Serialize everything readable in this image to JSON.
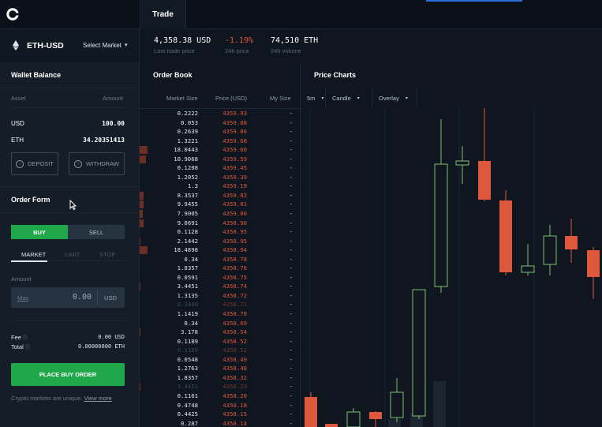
{
  "topbar": {
    "tab_trade": "Trade"
  },
  "market": {
    "pair": "ETH-USD",
    "select_label": "Select Market",
    "caret": "▾"
  },
  "stats": [
    {
      "value": "4,358.38 USD",
      "label": "Last trade price",
      "color": "#ffffff"
    },
    {
      "value": "-1.19%",
      "label": "24h price",
      "color": "#e0583b"
    },
    {
      "value": "74,510 ETH",
      "label": "24h volume",
      "color": "#ffffff"
    }
  ],
  "wallet": {
    "title": "Wallet Balance",
    "col_asset": "Asset",
    "col_amount": "Amount",
    "rows": [
      {
        "asset": "USD",
        "amount": "100.00"
      },
      {
        "asset": "ETH",
        "amount": "34.20351413"
      }
    ],
    "deposit": "DEPOSIT",
    "withdraw": "WITHDRAW"
  },
  "order_form": {
    "title": "Order Form",
    "buy": "BUY",
    "sell": "SELL",
    "types": [
      "MARKET",
      "LIMIT",
      "STOP"
    ],
    "amount_label": "Amount",
    "max": "Max",
    "amount_value": "0.00",
    "amount_unit": "USD",
    "fee_label": "Fee",
    "fee_value": "0.00 USD",
    "total_label": "Total",
    "total_value": "0.00000000 ETH",
    "info_mark": "ⓘ",
    "place_button": "PLACE BUY ORDER",
    "disclaimer": "Crypto markets are unique.",
    "view_more": "View more"
  },
  "order_book": {
    "title": "Order Book",
    "col_market_size": "Market Size",
    "col_price": "Price (USD)",
    "col_my_size": "My Size",
    "rows": [
      {
        "size": "0.2222",
        "price": "4359.93",
        "depth": 0
      },
      {
        "size": "0.053",
        "price": "4359.88",
        "depth": 0
      },
      {
        "size": "0.2639",
        "price": "4359.86",
        "depth": 0
      },
      {
        "size": "1.3221",
        "price": "4359.68",
        "depth": 0
      },
      {
        "size": "18.0443",
        "price": "4359.60",
        "depth": 10
      },
      {
        "size": "10.9068",
        "price": "4359.59",
        "depth": 8
      },
      {
        "size": "0.1208",
        "price": "4359.45",
        "depth": 0
      },
      {
        "size": "1.2052",
        "price": "4359.39",
        "depth": 0
      },
      {
        "size": "1.3",
        "price": "4359.19",
        "depth": 0
      },
      {
        "size": "8.3537",
        "price": "4359.02",
        "depth": 5
      },
      {
        "size": "9.9455",
        "price": "4359.01",
        "depth": 5
      },
      {
        "size": "7.9005",
        "price": "4359.00",
        "depth": 4
      },
      {
        "size": "9.0691",
        "price": "4358.98",
        "depth": 5
      },
      {
        "size": "0.1128",
        "price": "4358.95",
        "depth": 0
      },
      {
        "size": "2.1442",
        "price": "4358.95",
        "depth": 1
      },
      {
        "size": "18.4898",
        "price": "4358.94",
        "depth": 10
      },
      {
        "size": "0.34",
        "price": "4358.78",
        "depth": 0
      },
      {
        "size": "1.8357",
        "price": "4358.76",
        "depth": 0
      },
      {
        "size": "0.0591",
        "price": "4358.75",
        "depth": 0
      },
      {
        "size": "3.4451",
        "price": "4358.74",
        "depth": 1
      },
      {
        "size": "1.3135",
        "price": "4358.72",
        "depth": 0
      },
      {
        "size": "0.3400",
        "price": "4358.71",
        "depth": 0,
        "dim": true
      },
      {
        "size": "1.1419",
        "price": "4358.70",
        "depth": 0
      },
      {
        "size": "0.34",
        "price": "4358.69",
        "depth": 0
      },
      {
        "size": "3.178",
        "price": "4358.54",
        "depth": 1
      },
      {
        "size": "0.1189",
        "price": "4358.52",
        "depth": 0
      },
      {
        "size": "0.1189",
        "price": "4358.51",
        "depth": 0,
        "dim": true
      },
      {
        "size": "0.0548",
        "price": "4358.49",
        "depth": 0
      },
      {
        "size": "1.2763",
        "price": "4358.48",
        "depth": 0
      },
      {
        "size": "1.8357",
        "price": "4358.32",
        "depth": 0
      },
      {
        "size": "3.4451",
        "price": "4358.23",
        "depth": 1,
        "dim": true
      },
      {
        "size": "0.1161",
        "price": "4358.20",
        "depth": 0
      },
      {
        "size": "0.4748",
        "price": "4358.18",
        "depth": 0
      },
      {
        "size": "0.4425",
        "price": "4358.15",
        "depth": 0
      },
      {
        "size": "0.287",
        "price": "4358.14",
        "depth": 0
      }
    ]
  },
  "price_charts": {
    "title": "Price Charts",
    "interval": "5m",
    "chart_type": "Candle",
    "overlay": "Overlay",
    "up_color": "#7fbf73",
    "down_color": "#e0583b"
  },
  "colors": {
    "buy_green": "#1fa74a",
    "sell_red": "#e0583b"
  }
}
